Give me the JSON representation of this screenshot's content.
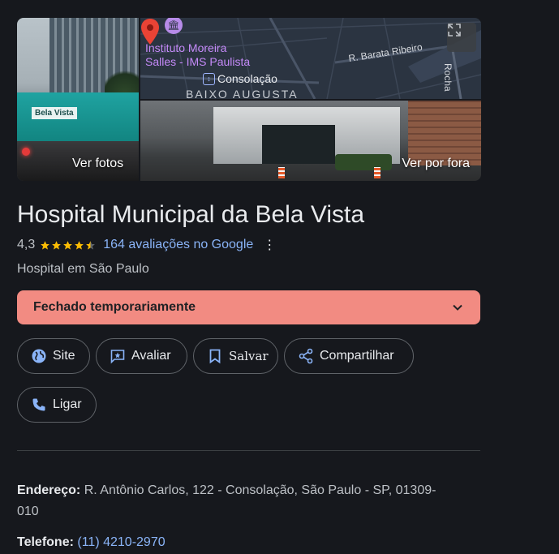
{
  "photos": {
    "left_caption": "Ver fotos",
    "right_caption": "Ver por fora",
    "sign_text": "Bela Vista"
  },
  "map": {
    "poi_label_line1": "Instituto Moreira",
    "poi_label_line2": "Salles - IMS Paulista",
    "metro_label": "Consolação",
    "street_1": "R. Barata Ribeiro",
    "street_2": "Rocha",
    "district": "BAIXO AUGUSTA",
    "pin_color": "#ea4335"
  },
  "place": {
    "title": "Hospital Municipal da Bela Vista",
    "rating": "4,3",
    "stars": 4.3,
    "reviews": "164 avaliações no Google",
    "category": "Hospital em São Paulo",
    "status": "Fechado temporariamente",
    "status_color": "#f28b82"
  },
  "actions": {
    "site": "Site",
    "avaliar": "Avaliar",
    "salvar": "Salvar",
    "compartilhar": "Compartilhar",
    "ligar": "Ligar"
  },
  "info": {
    "address_label": "Endereço:",
    "address_line1": "R. Antônio Carlos, 122 - Consolação, São Paulo - SP, 01309-",
    "address_line2": "010",
    "phone_label": "Telefone:",
    "phone_value": "(11) 4210-2970"
  },
  "colors": {
    "background": "#16181d",
    "link": "#8ab4f8",
    "star": "#fbbc04",
    "accent": "#8ab4f8"
  }
}
